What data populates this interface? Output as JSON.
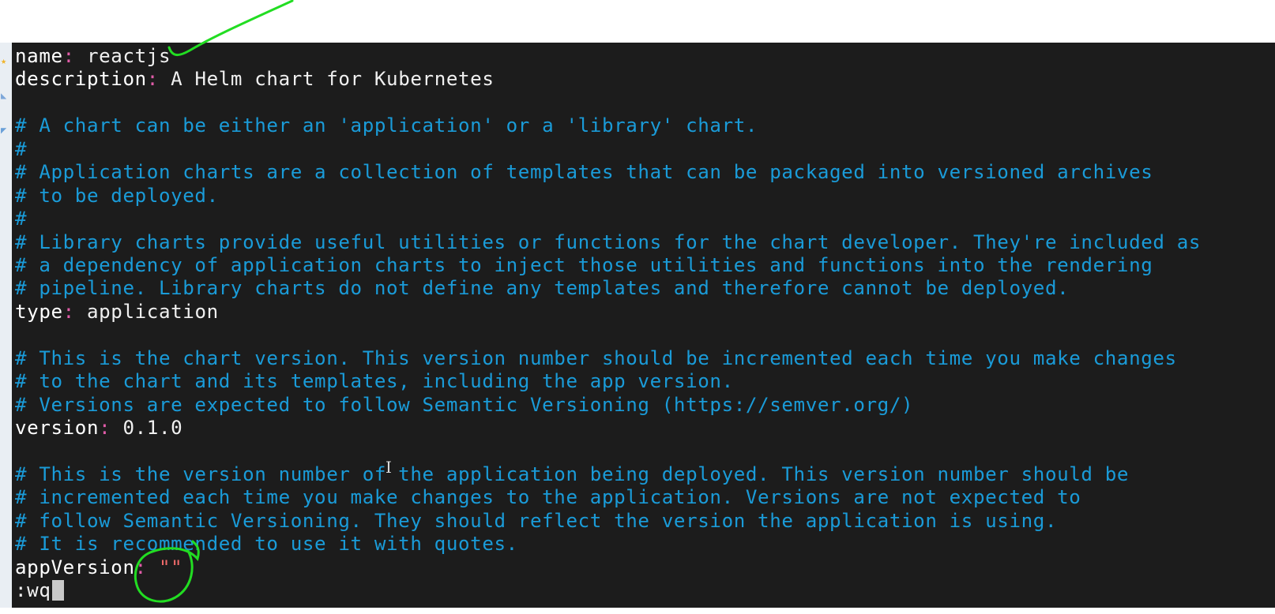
{
  "editor": {
    "lines": [
      {
        "type": "kv",
        "key": "name",
        "value": "reactjs"
      },
      {
        "type": "kv",
        "key": "description",
        "value": "A Helm chart for Kubernetes"
      },
      {
        "type": "blank"
      },
      {
        "type": "comment",
        "text": "# A chart can be either an 'application' or a 'library' chart."
      },
      {
        "type": "comment",
        "text": "#"
      },
      {
        "type": "comment",
        "text": "# Application charts are a collection of templates that can be packaged into versioned archives"
      },
      {
        "type": "comment",
        "text": "# to be deployed."
      },
      {
        "type": "comment",
        "text": "#"
      },
      {
        "type": "comment",
        "text": "# Library charts provide useful utilities or functions for the chart developer. They're included as"
      },
      {
        "type": "comment",
        "text": "# a dependency of application charts to inject those utilities and functions into the rendering"
      },
      {
        "type": "comment",
        "text": "# pipeline. Library charts do not define any templates and therefore cannot be deployed."
      },
      {
        "type": "kv",
        "key": "type",
        "value": "application"
      },
      {
        "type": "blank"
      },
      {
        "type": "comment",
        "text": "# This is the chart version. This version number should be incremented each time you make changes"
      },
      {
        "type": "comment",
        "text": "# to the chart and its templates, including the app version."
      },
      {
        "type": "comment",
        "text": "# Versions are expected to follow Semantic Versioning (https://semver.org/)"
      },
      {
        "type": "kv",
        "key": "version",
        "value": "0.1.0"
      },
      {
        "type": "blank"
      },
      {
        "type": "comment",
        "text": "# This is the version number of the application being deployed. This version number should be"
      },
      {
        "type": "comment",
        "text": "# incremented each time you make changes to the application. Versions are not expected to"
      },
      {
        "type": "comment",
        "text": "# follow Semantic Versioning. They should reflect the version the application is using."
      },
      {
        "type": "comment",
        "text": "# It is recommended to use it with quotes."
      },
      {
        "type": "kv_string",
        "key": "appVersion",
        "value": "\"\""
      },
      {
        "type": "command",
        "text": ":wq"
      }
    ],
    "separator": ": "
  },
  "colors": {
    "background": "#1c1c1c",
    "key": "#ffffff",
    "colon": "#e05ca8",
    "comment": "#1a9bd8",
    "string": "#ef6a6a",
    "annotation": "#22dd22"
  },
  "icons": {
    "mouse_cursor": "I"
  }
}
